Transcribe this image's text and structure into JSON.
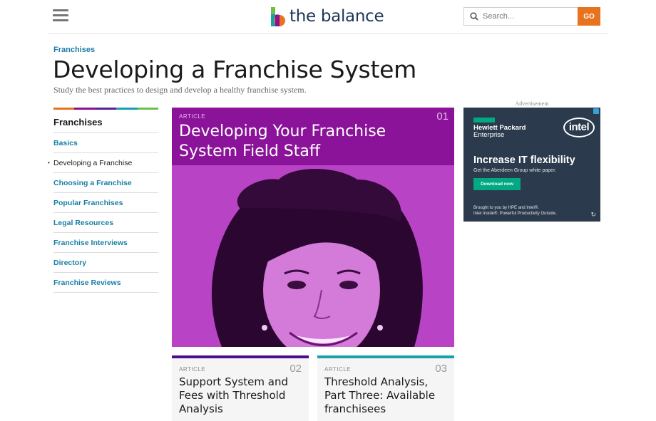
{
  "header": {
    "menu_icon": "hamburger-menu-icon",
    "logo_text": "the balance",
    "search": {
      "placeholder": "Search...",
      "button_label": "GO",
      "icon": "search-icon"
    },
    "colors": {
      "go_button": "#e8731f",
      "logo_text": "#1c3557"
    }
  },
  "breadcrumb": "Franchises",
  "page_title": "Developing a Franchise System",
  "subtitle": "Study the best practices to design and develop a healthy franchise system.",
  "sidebar": {
    "heading": "Franchises",
    "color_bar": [
      "#e8731f",
      "#8e0f95",
      "#5b1f99",
      "#17a2a8",
      "#6cc04a"
    ],
    "items": [
      {
        "label": "Basics",
        "active": false
      },
      {
        "label": "Developing a Franchise",
        "active": true
      },
      {
        "label": "Choosing a Franchise",
        "active": false
      },
      {
        "label": "Popular Franchises",
        "active": false
      },
      {
        "label": "Legal Resources",
        "active": false
      },
      {
        "label": "Franchise Interviews",
        "active": false
      },
      {
        "label": "Directory",
        "active": false
      },
      {
        "label": "Franchise Reviews",
        "active": false
      }
    ]
  },
  "articles": [
    {
      "tag": "ARTICLE",
      "number": "01",
      "title": "Developing Your Franchise System Field Staff",
      "accent": "#8e0f95"
    },
    {
      "tag": "ARTICLE",
      "number": "02",
      "title": "Support System and Fees with Threshold Analysis",
      "accent": "#4b0d8c"
    },
    {
      "tag": "ARTICLE",
      "number": "03",
      "title": "Threshold Analysis, Part Three: Available franchisees",
      "accent": "#17a2a8"
    }
  ],
  "ad": {
    "label": "Advertisement",
    "brand_1": "Hewlett Packard",
    "brand_1b": "Enterprise",
    "brand_2": "intel",
    "headline": "Increase IT flexibility",
    "subline": "Get the Aberdeen Group white paper.",
    "button": "Download now",
    "footer_1": "Brought to you by HPE and Intel®.",
    "footer_2": "Intel Inside®. Powerful Productivity Outside."
  }
}
